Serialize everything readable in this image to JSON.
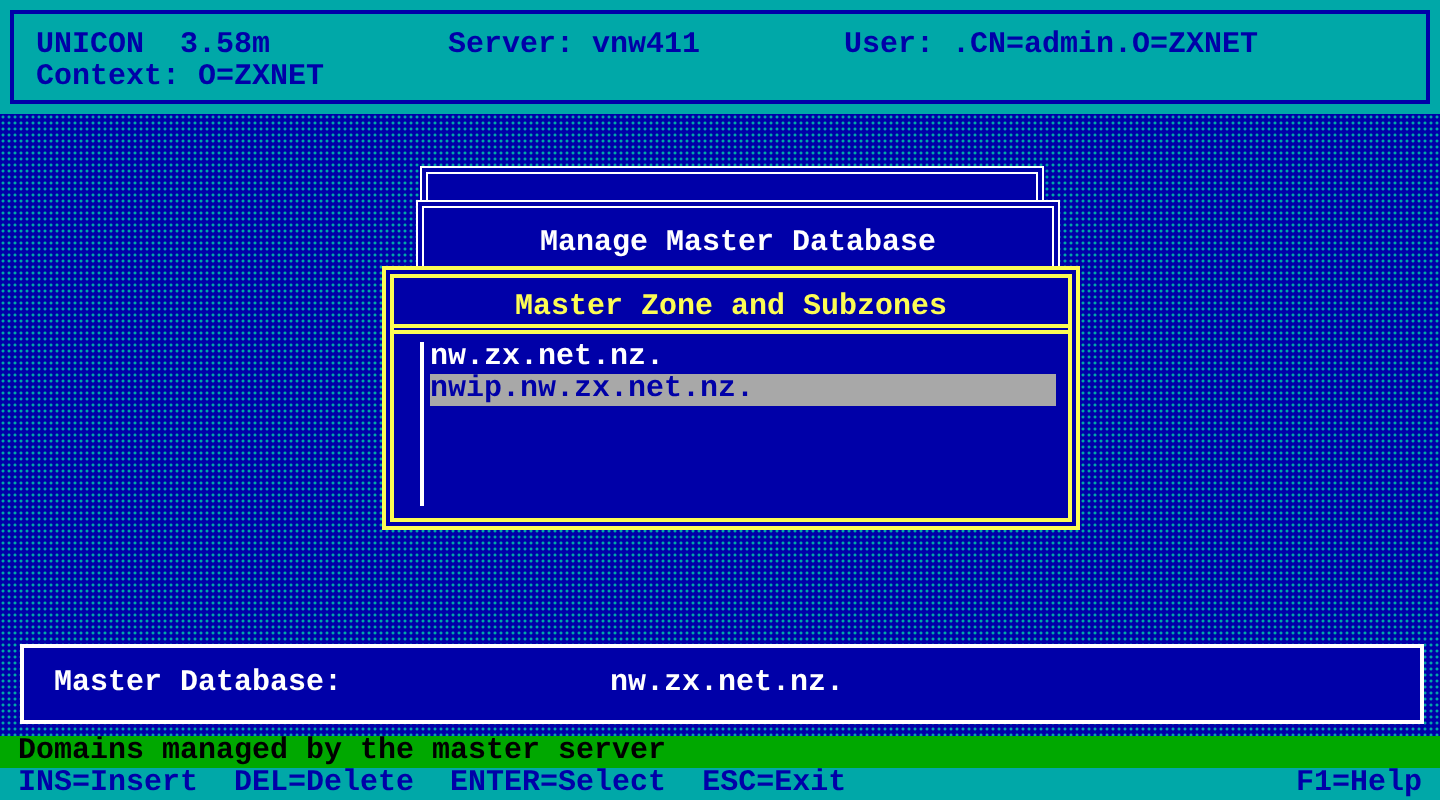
{
  "header": {
    "app_name": "UNICON",
    "version": "3.58m",
    "server": "Server: vnw411",
    "user": "User: .CN=admin.O=ZXNET",
    "context": "Context: O=ZXNET"
  },
  "back_window": {
    "title": "Manage Master Database"
  },
  "dialog": {
    "title": "Master Zone and Subzones",
    "items": [
      {
        "label": "nw.zx.net.nz.",
        "selected": false
      },
      {
        "label": "nwip.nw.zx.net.nz.",
        "selected": true
      }
    ]
  },
  "info_panel": {
    "label": "Master Database:",
    "value": "nw.zx.net.nz."
  },
  "status_line": "Domains managed by the master server",
  "key_hints": [
    {
      "label": "INS=Insert"
    },
    {
      "label": "DEL=Delete"
    },
    {
      "label": "ENTER=Select"
    },
    {
      "label": "ESC=Exit"
    }
  ],
  "help_key": "F1=Help"
}
